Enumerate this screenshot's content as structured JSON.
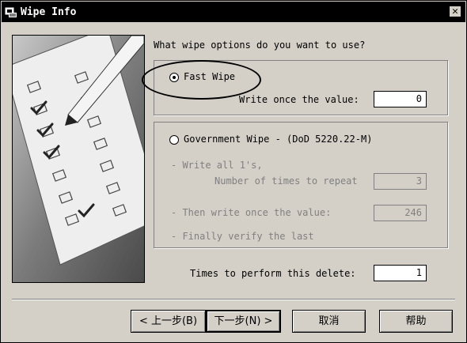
{
  "window": {
    "title": "Wipe Info",
    "close_symbol": "✕",
    "icons": [
      "app-icon",
      "close-icon"
    ]
  },
  "question": "What wipe options do you want to use?",
  "fast_wipe": {
    "label": "Fast Wipe",
    "selected": true,
    "write_once_label": "Write once the value:",
    "write_once_value": "0"
  },
  "government_wipe": {
    "label": "Government Wipe - (DoD 5220.22-M)",
    "selected": false,
    "write_all_label": "- Write all 1's,",
    "repeat_label": "Number of times to repeat",
    "repeat_value": "3",
    "then_write_label": "- Then write once the value:",
    "then_write_value": "246",
    "finally_label": "- Finally verify the last"
  },
  "times": {
    "label": "Times to perform this delete:",
    "value": "1"
  },
  "buttons": {
    "back": "< 上一步(B)",
    "next": "下一步(N) >",
    "cancel": "取消",
    "help": "帮助"
  },
  "colors": {
    "face": "#d4d0c8",
    "titlebar": "#000000",
    "disabled_text": "#808080"
  }
}
